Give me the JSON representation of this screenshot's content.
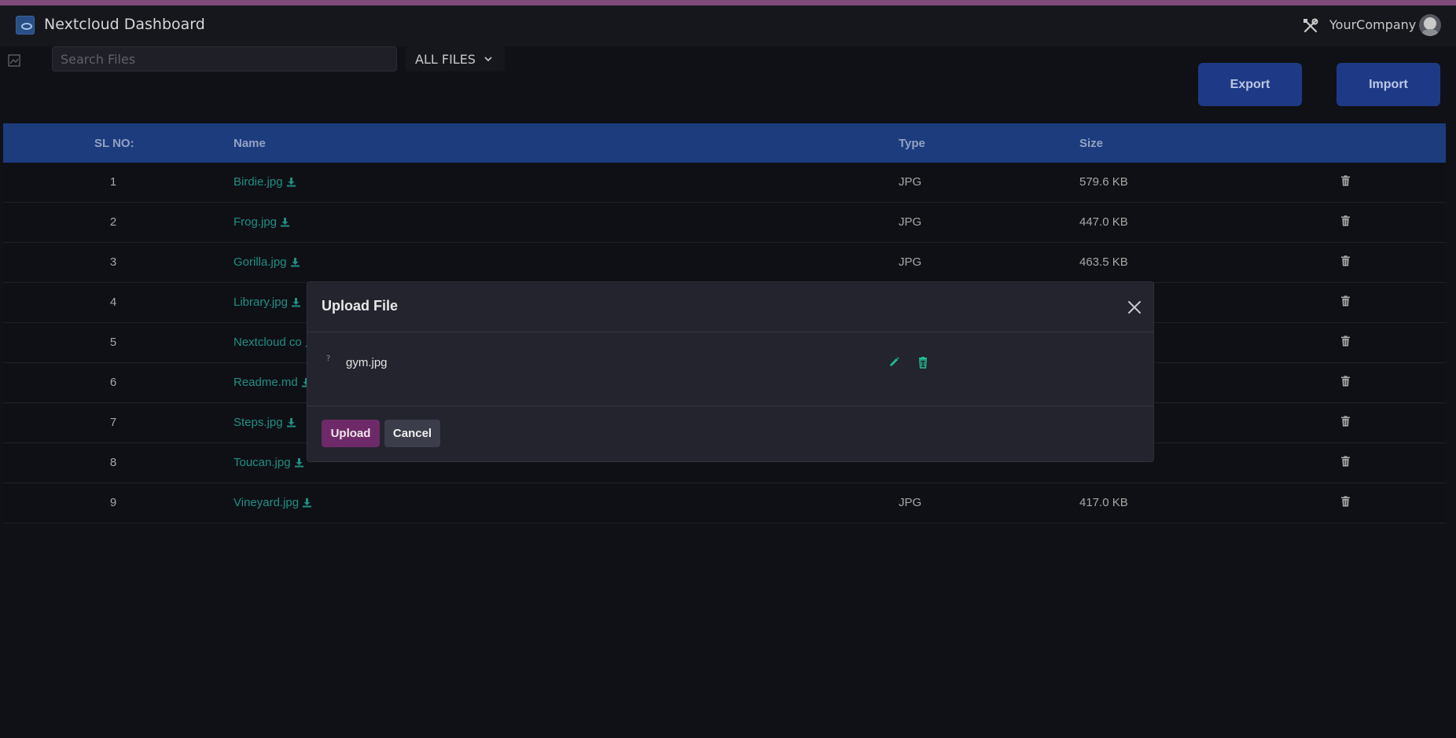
{
  "app": {
    "title": "Nextcloud Dashboard",
    "company": "YourCompany",
    "icons": {
      "logo": "nextcloud-logo-icon",
      "tools": "tools-icon",
      "avatar": "user-avatar"
    }
  },
  "toolbar": {
    "search_placeholder": "Search Files",
    "filter_label": "ALL FILES",
    "export_label": "Export",
    "import_label": "Import"
  },
  "table": {
    "headers": {
      "sl": "SL NO:",
      "name": "Name",
      "type": "Type",
      "size": "Size"
    },
    "rows": [
      {
        "sl": "1",
        "name": "Birdie.jpg",
        "type": "JPG",
        "size": "579.6 KB"
      },
      {
        "sl": "2",
        "name": "Frog.jpg",
        "type": "JPG",
        "size": "447.0 KB"
      },
      {
        "sl": "3",
        "name": "Gorilla.jpg",
        "type": "JPG",
        "size": "463.5 KB"
      },
      {
        "sl": "4",
        "name": "Library.jpg",
        "type": "",
        "size": ""
      },
      {
        "sl": "5",
        "name": "Nextcloud co",
        "type": "",
        "size": ""
      },
      {
        "sl": "6",
        "name": "Readme.md",
        "type": "",
        "size": ""
      },
      {
        "sl": "7",
        "name": "Steps.jpg",
        "type": "",
        "size": ""
      },
      {
        "sl": "8",
        "name": "Toucan.jpg",
        "type": "",
        "size": ""
      },
      {
        "sl": "9",
        "name": "Vineyard.jpg",
        "type": "JPG",
        "size": "417.0 KB"
      }
    ]
  },
  "modal": {
    "title": "Upload File",
    "file_marker": "?",
    "file_name": "gym.jpg",
    "upload_label": "Upload",
    "cancel_label": "Cancel"
  },
  "colors": {
    "accent_stripe": "#7e4a77",
    "header_blue": "#1c3c7e",
    "button_blue": "#1e3a86",
    "link_teal": "#1f8f83",
    "upload_purple": "#6e2a68",
    "action_green": "#1fbf8f"
  }
}
